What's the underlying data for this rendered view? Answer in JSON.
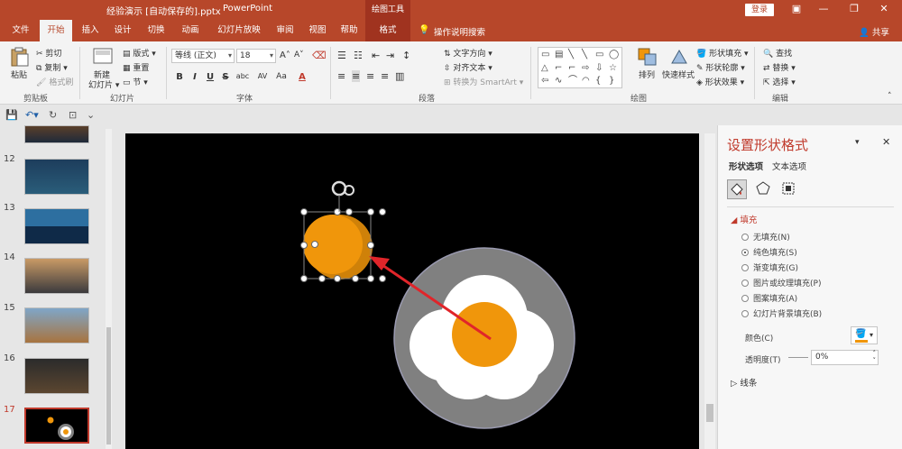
{
  "window": {
    "doc_title": "经验演示 [自动保存的].pptx",
    "app_name": "PowerPoint",
    "contextual_group": "绘图工具",
    "login_label": "登录"
  },
  "tabs": [
    {
      "label": "文件"
    },
    {
      "label": "开始"
    },
    {
      "label": "插入"
    },
    {
      "label": "设计"
    },
    {
      "label": "切换"
    },
    {
      "label": "动画"
    },
    {
      "label": "幻灯片放映"
    },
    {
      "label": "审阅"
    },
    {
      "label": "视图"
    },
    {
      "label": "帮助"
    },
    {
      "label": "格式"
    }
  ],
  "active_tab": "开始",
  "tell_me": "操作说明搜索",
  "share_label": "共享",
  "ribbon": {
    "clipboard": {
      "paste": "粘贴",
      "cut": "剪切",
      "copy": "复制",
      "format_painter": "格式刷",
      "label": "剪贴板"
    },
    "slides": {
      "new_slide": "新建",
      "new_slide2": "幻灯片",
      "layout": "版式",
      "reset": "重置",
      "section": "节",
      "label": "幻灯片"
    },
    "font": {
      "name": "等线 (正文)",
      "size": "18",
      "label": "字体",
      "bold": "B",
      "italic": "I",
      "underline": "U",
      "strike": "S",
      "shadow": "abc",
      "spacing": "AV",
      "case": "Aa",
      "grow": "A",
      "shrink": "A"
    },
    "paragraph": {
      "text_direction": "文字方向",
      "align_text": "对齐文本",
      "smartart": "转换为 SmartArt",
      "label": "段落"
    },
    "drawing": {
      "arrange": "排列",
      "quick_styles": "快速样式",
      "shape_fill": "形状填充",
      "shape_outline": "形状轮廓",
      "shape_effects": "形状效果",
      "label": "绘图"
    },
    "editing": {
      "find": "查找",
      "replace": "替换",
      "select": "选择",
      "label": "编辑"
    }
  },
  "slides": [
    {
      "num": "12"
    },
    {
      "num": "13"
    },
    {
      "num": "14"
    },
    {
      "num": "15"
    },
    {
      "num": "16"
    },
    {
      "num": "17"
    }
  ],
  "format_pane": {
    "title": "设置形状格式",
    "tab_shape": "形状选项",
    "tab_text": "文本选项",
    "section_fill": "填充",
    "fill_options": [
      {
        "label": "无填充(N)",
        "selected": false
      },
      {
        "label": "纯色填充(S)",
        "selected": true
      },
      {
        "label": "渐变填充(G)",
        "selected": false
      },
      {
        "label": "图片或纹理填充(P)",
        "selected": false
      },
      {
        "label": "图案填充(A)",
        "selected": false
      },
      {
        "label": "幻灯片背景填充(B)",
        "selected": false
      }
    ],
    "color_label": "颜色(C)",
    "transparency_label": "透明度(T)",
    "transparency_value": "0%",
    "section_line": "线条"
  },
  "colors": {
    "accent": "#b7472a",
    "egg_yolk": "#f0960b",
    "egg_white": "#ffffff",
    "plate": "#808080",
    "arrow": "#e0252a"
  }
}
